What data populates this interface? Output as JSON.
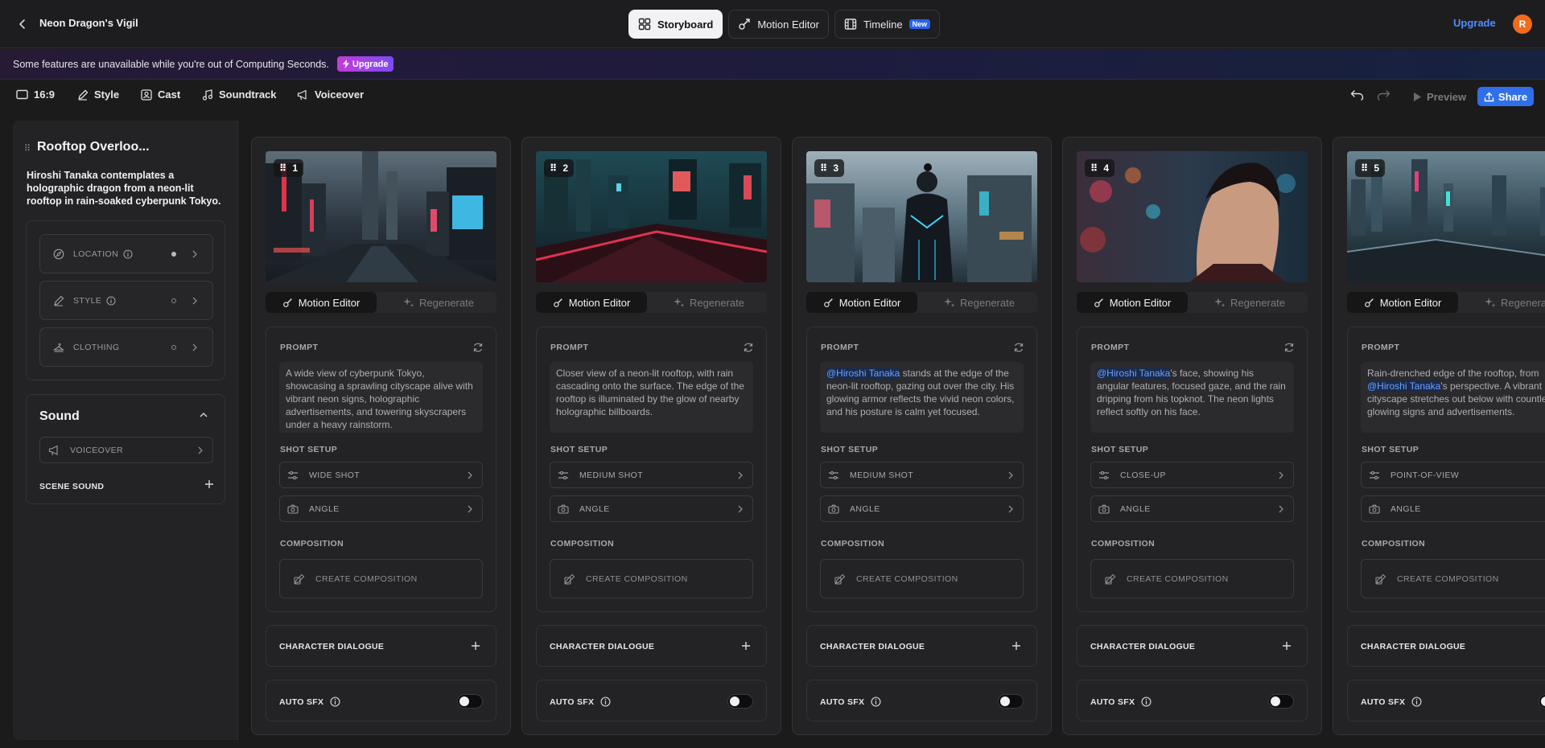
{
  "header": {
    "project_title": "Neon Dragon's Vigil",
    "tabs": [
      {
        "label": "Storyboard",
        "icon": "grid-icon"
      },
      {
        "label": "Motion Editor",
        "icon": "motion-icon"
      },
      {
        "label": "Timeline",
        "icon": "film-icon",
        "badge": "New"
      }
    ],
    "upgrade_label": "Upgrade",
    "avatar_initial": "R"
  },
  "banner": {
    "message": "Some features are unavailable while you're out of Computing Seconds.",
    "upgrade_label": "Upgrade"
  },
  "toolbar": {
    "aspect_ratio": "16:9",
    "style_label": "Style",
    "cast_label": "Cast",
    "soundtrack_label": "Soundtrack",
    "voiceover_label": "Voiceover",
    "preview_label": "Preview",
    "share_label": "Share"
  },
  "scene": {
    "title": "Rooftop Overloo...",
    "description": "Hiroshi Tanaka contemplates a holographic dragon from a neon-lit rooftop in rain-soaked cyberpunk Tokyo.",
    "properties": [
      {
        "label": "LOCATION",
        "filled": true
      },
      {
        "label": "STYLE",
        "filled": false
      },
      {
        "label": "CLOTHING",
        "filled": false
      }
    ],
    "sound": {
      "title": "Sound",
      "voiceover_label": "VOICEOVER",
      "scene_sound_label": "SCENE SOUND"
    }
  },
  "shot_labels": {
    "motion_editor": "Motion Editor",
    "regenerate": "Regenerate",
    "prompt": "PROMPT",
    "shot_setup": "SHOT SETUP",
    "angle": "ANGLE",
    "composition": "COMPOSITION",
    "create_composition": "CREATE COMPOSITION",
    "character_dialogue": "CHARACTER DIALOGUE",
    "auto_sfx": "AUTO SFX"
  },
  "shots": [
    {
      "number": "1",
      "shot_type": "WIDE SHOT",
      "mention": "",
      "prompt": "A wide view of cyberpunk Tokyo, showcasing a sprawling cityscape alive with vibrant neon signs, holographic advertisements, and towering skyscrapers under a heavy rainstorm.",
      "auto_sfx": false
    },
    {
      "number": "2",
      "shot_type": "MEDIUM SHOT",
      "mention": "",
      "prompt": "Closer view of a neon-lit rooftop, with rain cascading onto the surface. The edge of the rooftop is illuminated by the glow of nearby holographic billboards.",
      "auto_sfx": false
    },
    {
      "number": "3",
      "shot_type": "MEDIUM SHOT",
      "mention": "@Hiroshi Tanaka",
      "prompt": " stands at the edge of the neon-lit rooftop, gazing out over the city. His glowing armor reflects the vivid neon colors, and his posture is calm yet focused.",
      "auto_sfx": false
    },
    {
      "number": "4",
      "shot_type": "CLOSE-UP",
      "mention": "@Hiroshi Tanaka",
      "prompt": "'s face, showing his angular features, focused gaze, and the rain dripping from his topknot. The neon lights reflect softly on his face.",
      "auto_sfx": false
    },
    {
      "number": "5",
      "shot_type": "POINT-OF-VIEW",
      "prompt_pre": "Rain-drenched edge of the rooftop, from ",
      "mention": "@Hiroshi Tanaka",
      "prompt": "'s perspective. A vibrant cityscape stretches out below with countless glowing signs and advertisements.",
      "auto_sfx": false
    }
  ]
}
